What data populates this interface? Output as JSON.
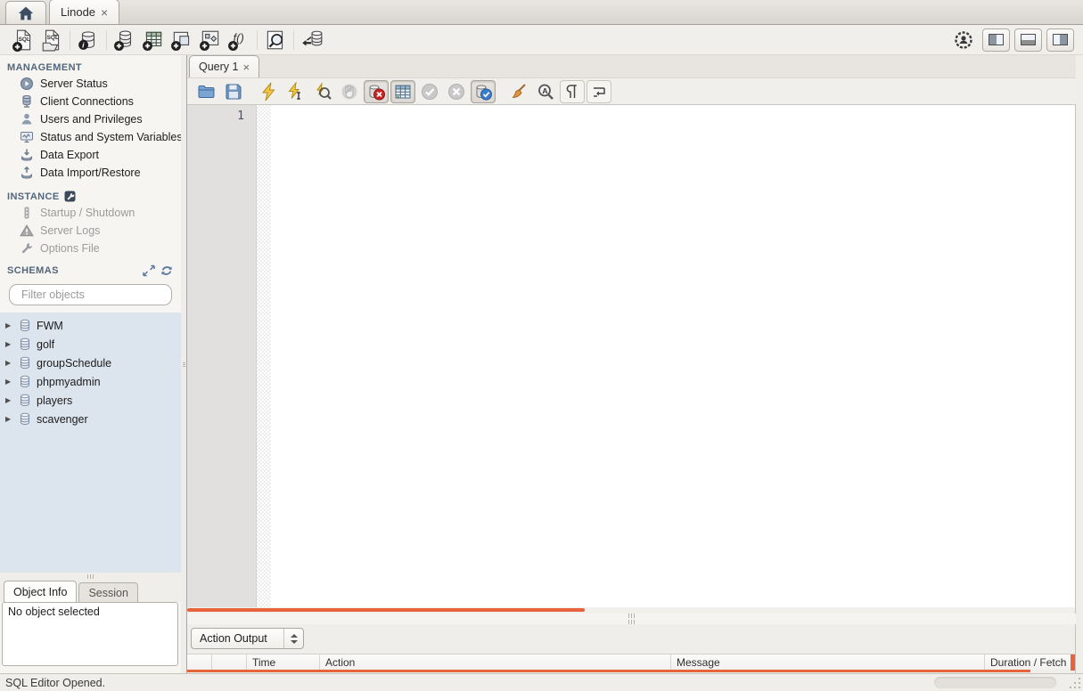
{
  "window_tabs": {
    "home_icon": "home-icon",
    "tabs": [
      {
        "label": "Linode",
        "close_label": "×"
      }
    ]
  },
  "main_toolbar": {
    "icon_buttons": [
      "new-sql-tab",
      "open-sql-script",
      "connection-info",
      "new-schema",
      "new-table",
      "new-view",
      "new-procedure",
      "new-function",
      "search-objects",
      "reconnect-database"
    ],
    "right_buttons": [
      "admin-preferences",
      "toggle-left-panel",
      "toggle-bottom-panel",
      "toggle-right-panel"
    ]
  },
  "sidebar": {
    "management": {
      "title": "MANAGEMENT",
      "items": [
        {
          "icon": "server-status-icon",
          "label": "Server Status"
        },
        {
          "icon": "client-connections-icon",
          "label": "Client Connections"
        },
        {
          "icon": "users-privileges-icon",
          "label": "Users and Privileges"
        },
        {
          "icon": "status-variables-icon",
          "label": "Status and System Variables"
        },
        {
          "icon": "data-export-icon",
          "label": "Data Export"
        },
        {
          "icon": "data-import-icon",
          "label": "Data Import/Restore"
        }
      ]
    },
    "instance": {
      "title": "INSTANCE",
      "items": [
        {
          "icon": "startup-shutdown-icon",
          "label": "Startup / Shutdown",
          "disabled": true
        },
        {
          "icon": "server-logs-icon",
          "label": "Server Logs",
          "disabled": true
        },
        {
          "icon": "options-file-icon",
          "label": "Options File",
          "disabled": true
        }
      ]
    },
    "schemas": {
      "title": "SCHEMAS",
      "header_icons": [
        "expand-panel-icon",
        "refresh-schemas-icon"
      ],
      "filter_placeholder": "Filter objects",
      "items": [
        "FWM",
        "golf",
        "groupSchedule",
        "phpmyadmin",
        "players",
        "scavenger"
      ]
    },
    "info_panel": {
      "tabs": [
        "Object Info",
        "Session"
      ],
      "active_tab": "Object Info",
      "content": "No object selected"
    }
  },
  "editor": {
    "tab_label": "Query 1",
    "tab_close": "×",
    "line_number": "1",
    "content": "",
    "toolbar_icons": [
      "open-script",
      "save-script",
      "execute",
      "execute-current",
      "explain",
      "stop",
      "toggle-stop-on-error",
      "limit-rows",
      "commit",
      "rollback",
      "toggle-autocommit",
      "beautify",
      "find",
      "show-invisibles",
      "toggle-wrap"
    ]
  },
  "output": {
    "view_selector": "Action Output",
    "columns": [
      "",
      "",
      "Time",
      "Action",
      "Message",
      "Duration / Fetch"
    ]
  },
  "status_bar": {
    "message": "SQL Editor Opened."
  },
  "icons": {
    "expander": "▶"
  },
  "colors": {
    "accent_orange": "#e7633b",
    "schema_panel_bg": "#dce4ee",
    "section_title": "#52667c"
  }
}
